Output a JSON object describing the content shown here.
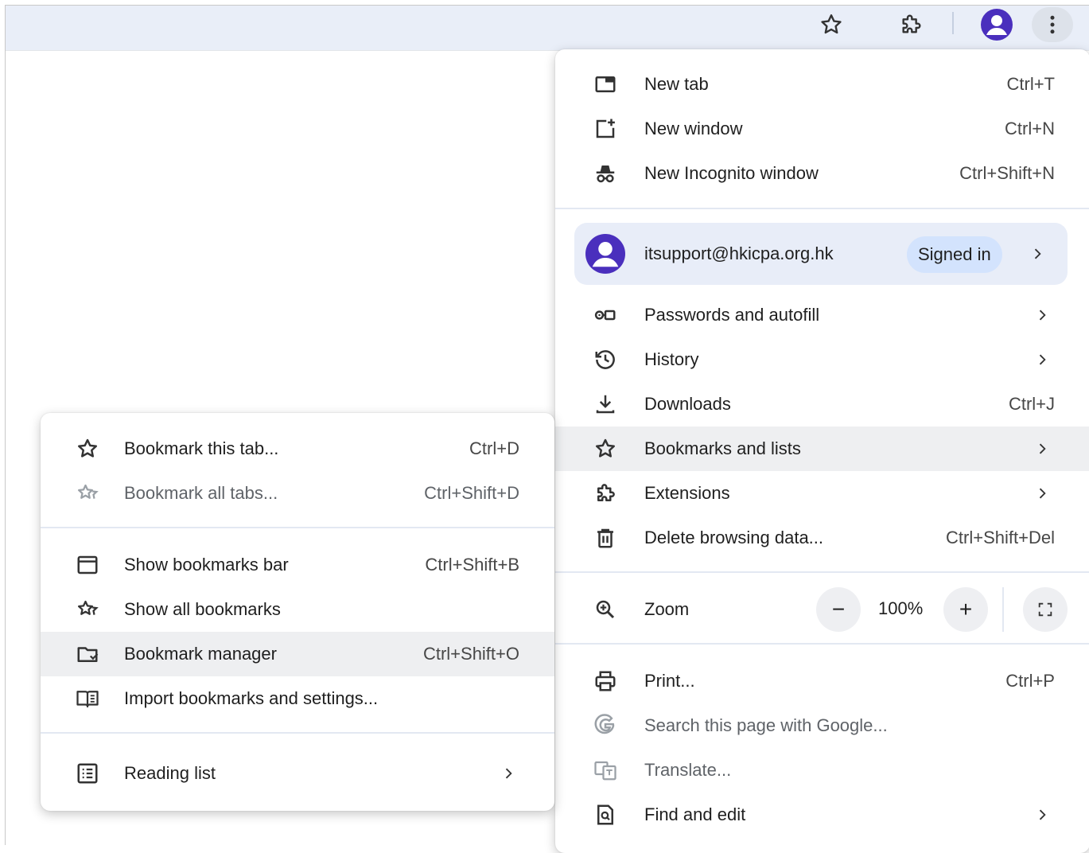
{
  "toolbar": {
    "icons": [
      "star-icon",
      "extensions-icon",
      "profile-avatar-icon",
      "more-vert-icon"
    ]
  },
  "main_menu": {
    "new_tab": {
      "label": "New tab",
      "shortcut": "Ctrl+T"
    },
    "new_window": {
      "label": "New window",
      "shortcut": "Ctrl+N"
    },
    "new_incognito": {
      "label": "New Incognito window",
      "shortcut": "Ctrl+Shift+N"
    },
    "account": {
      "email": "itsupport@hkicpa.org.hk",
      "status": "Signed in"
    },
    "passwords": {
      "label": "Passwords and autofill"
    },
    "history": {
      "label": "History"
    },
    "downloads": {
      "label": "Downloads",
      "shortcut": "Ctrl+J"
    },
    "bookmarks": {
      "label": "Bookmarks and lists"
    },
    "extensions": {
      "label": "Extensions"
    },
    "delete_data": {
      "label": "Delete browsing data...",
      "shortcut": "Ctrl+Shift+Del"
    },
    "zoom": {
      "label": "Zoom",
      "value": "100%",
      "minus": "−",
      "plus": "+"
    },
    "print": {
      "label": "Print...",
      "shortcut": "Ctrl+P"
    },
    "search_google": {
      "label": "Search this page with Google..."
    },
    "translate": {
      "label": "Translate..."
    },
    "find_edit": {
      "label": "Find and edit"
    }
  },
  "bookmarks_submenu": {
    "bookmark_tab": {
      "label": "Bookmark this tab...",
      "shortcut": "Ctrl+D"
    },
    "bookmark_all": {
      "label": "Bookmark all tabs...",
      "shortcut": "Ctrl+Shift+D"
    },
    "show_bar": {
      "label": "Show bookmarks bar",
      "shortcut": "Ctrl+Shift+B"
    },
    "show_all": {
      "label": "Show all bookmarks"
    },
    "manager": {
      "label": "Bookmark manager",
      "shortcut": "Ctrl+Shift+O"
    },
    "import": {
      "label": "Import bookmarks and settings..."
    },
    "reading_list": {
      "label": "Reading list"
    }
  },
  "colors": {
    "accent": "#4a2fbd",
    "toolbar_bg": "#e9eef8",
    "account_bg": "#e8edf8",
    "badge_bg": "#d3e3fd",
    "hover_bg": "#eeeff1"
  }
}
